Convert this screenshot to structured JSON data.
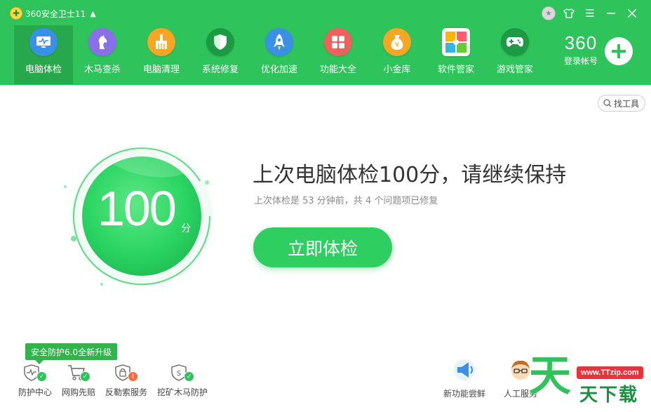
{
  "app": {
    "title": "360安全卫士11"
  },
  "nav": [
    {
      "key": "checkup",
      "label": "电脑体检",
      "color": "#3a8fe6"
    },
    {
      "key": "trojan",
      "label": "木马查杀",
      "color": "#8b6fe8"
    },
    {
      "key": "cleanup",
      "label": "电脑清理",
      "color": "#f6a623"
    },
    {
      "key": "repair",
      "label": "系统修复",
      "color": "#2fc35b"
    },
    {
      "key": "speedup",
      "label": "优化加速",
      "color": "#3a8fe6"
    },
    {
      "key": "features",
      "label": "功能大全",
      "color": "#f0605d"
    },
    {
      "key": "vault",
      "label": "小金库",
      "color": "#f5a623"
    },
    {
      "key": "software",
      "label": "软件管家",
      "color": "#3bb3e0"
    },
    {
      "key": "games",
      "label": "游戏管家",
      "color": "#2fc35b"
    }
  ],
  "login": {
    "brand": "360",
    "label": "登录帐号"
  },
  "find_tool": {
    "label": "找工具"
  },
  "score": {
    "value": "100",
    "unit": "分"
  },
  "headline": "上次电脑体检100分，请继续保持",
  "subline": "上次体检是 53 分钟前，共 4 个问题项已修复",
  "check_button": "立即体检",
  "upgrade_tip": "安全防护6.0全新升级",
  "bottom_left": [
    {
      "key": "protection",
      "label": "防护中心"
    },
    {
      "key": "shopping",
      "label": "网购先赔"
    },
    {
      "key": "ransom",
      "label": "反勒索服务"
    },
    {
      "key": "mining",
      "label": "挖矿木马防护"
    }
  ],
  "bottom_right": [
    {
      "key": "new",
      "label": "新功能尝鲜"
    },
    {
      "key": "service",
      "label": "人工服务"
    }
  ],
  "watermark": {
    "url": "www.TTzip.com",
    "text": "天下载",
    "glyph": "天"
  },
  "colors": {
    "brand_green": "#2fc35b",
    "active_nav": "#27a84c",
    "button_green": "#2fce60"
  }
}
